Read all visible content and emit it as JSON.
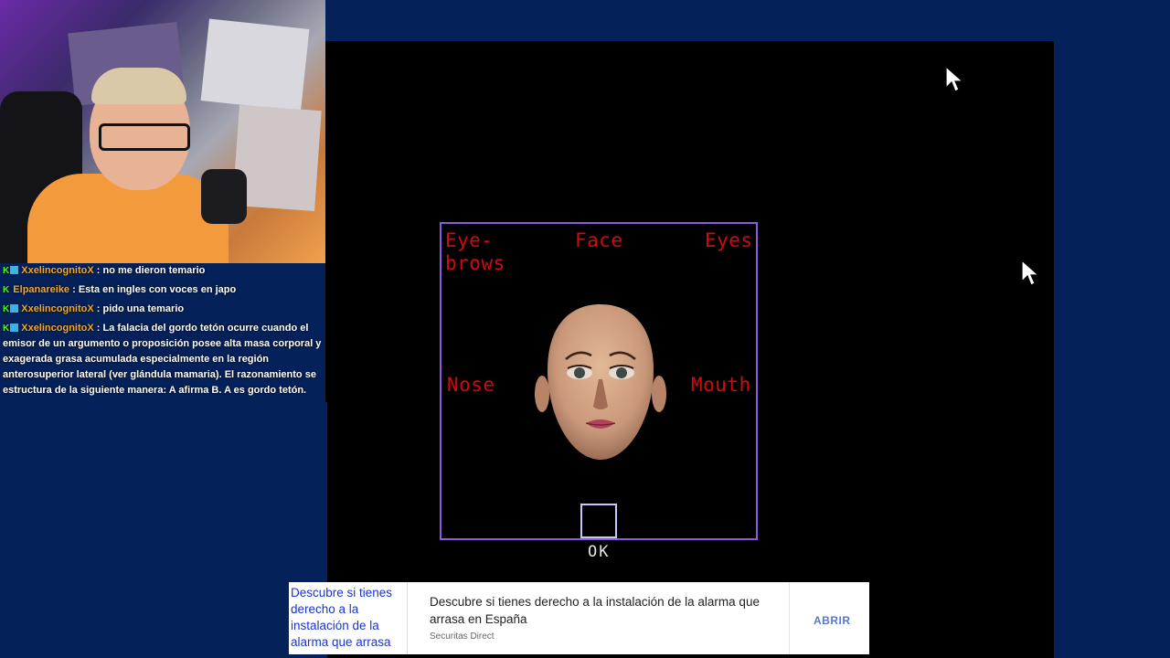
{
  "chat": {
    "messages": [
      {
        "user": "XxelincognitoX",
        "text": ": no me dieron temario"
      },
      {
        "user": "Elpanareike",
        "text": ": Esta en ingles con voces en japo"
      },
      {
        "user": "XxelincognitoX",
        "text": ": pido una temario"
      },
      {
        "user": "XxelincognitoX",
        "text": ": La falacia del gordo tetón ocurre cuando el emisor de un argumento o proposición posee alta masa corporal y exagerada grasa acumulada especialmente en la región anterosuperior lateral (ver glándula mamaria). El razonamiento se estructura de la siguiente manera: A afirma B. A es gordo tetón."
      }
    ]
  },
  "editor": {
    "eyebrows_label_line1": "Eye-",
    "eyebrows_label_line2": "brows",
    "face_label": "Face",
    "eyes_label": "Eyes",
    "nose_label": "Nose",
    "mouth_label": "Mouth",
    "ok_label": "OK"
  },
  "ad": {
    "image_alt": "Descubre si tienes derecho a la instalación de la alarma que arrasa",
    "title": "Descubre si tienes derecho a la instalación de la alarma que arrasa en España",
    "source": "Securitas Direct",
    "cta": "ABRIR"
  },
  "colors": {
    "background": "#04215a",
    "game_bg": "#000000",
    "label_red": "#d40a0a",
    "dialog_border": "#8a5adf"
  }
}
